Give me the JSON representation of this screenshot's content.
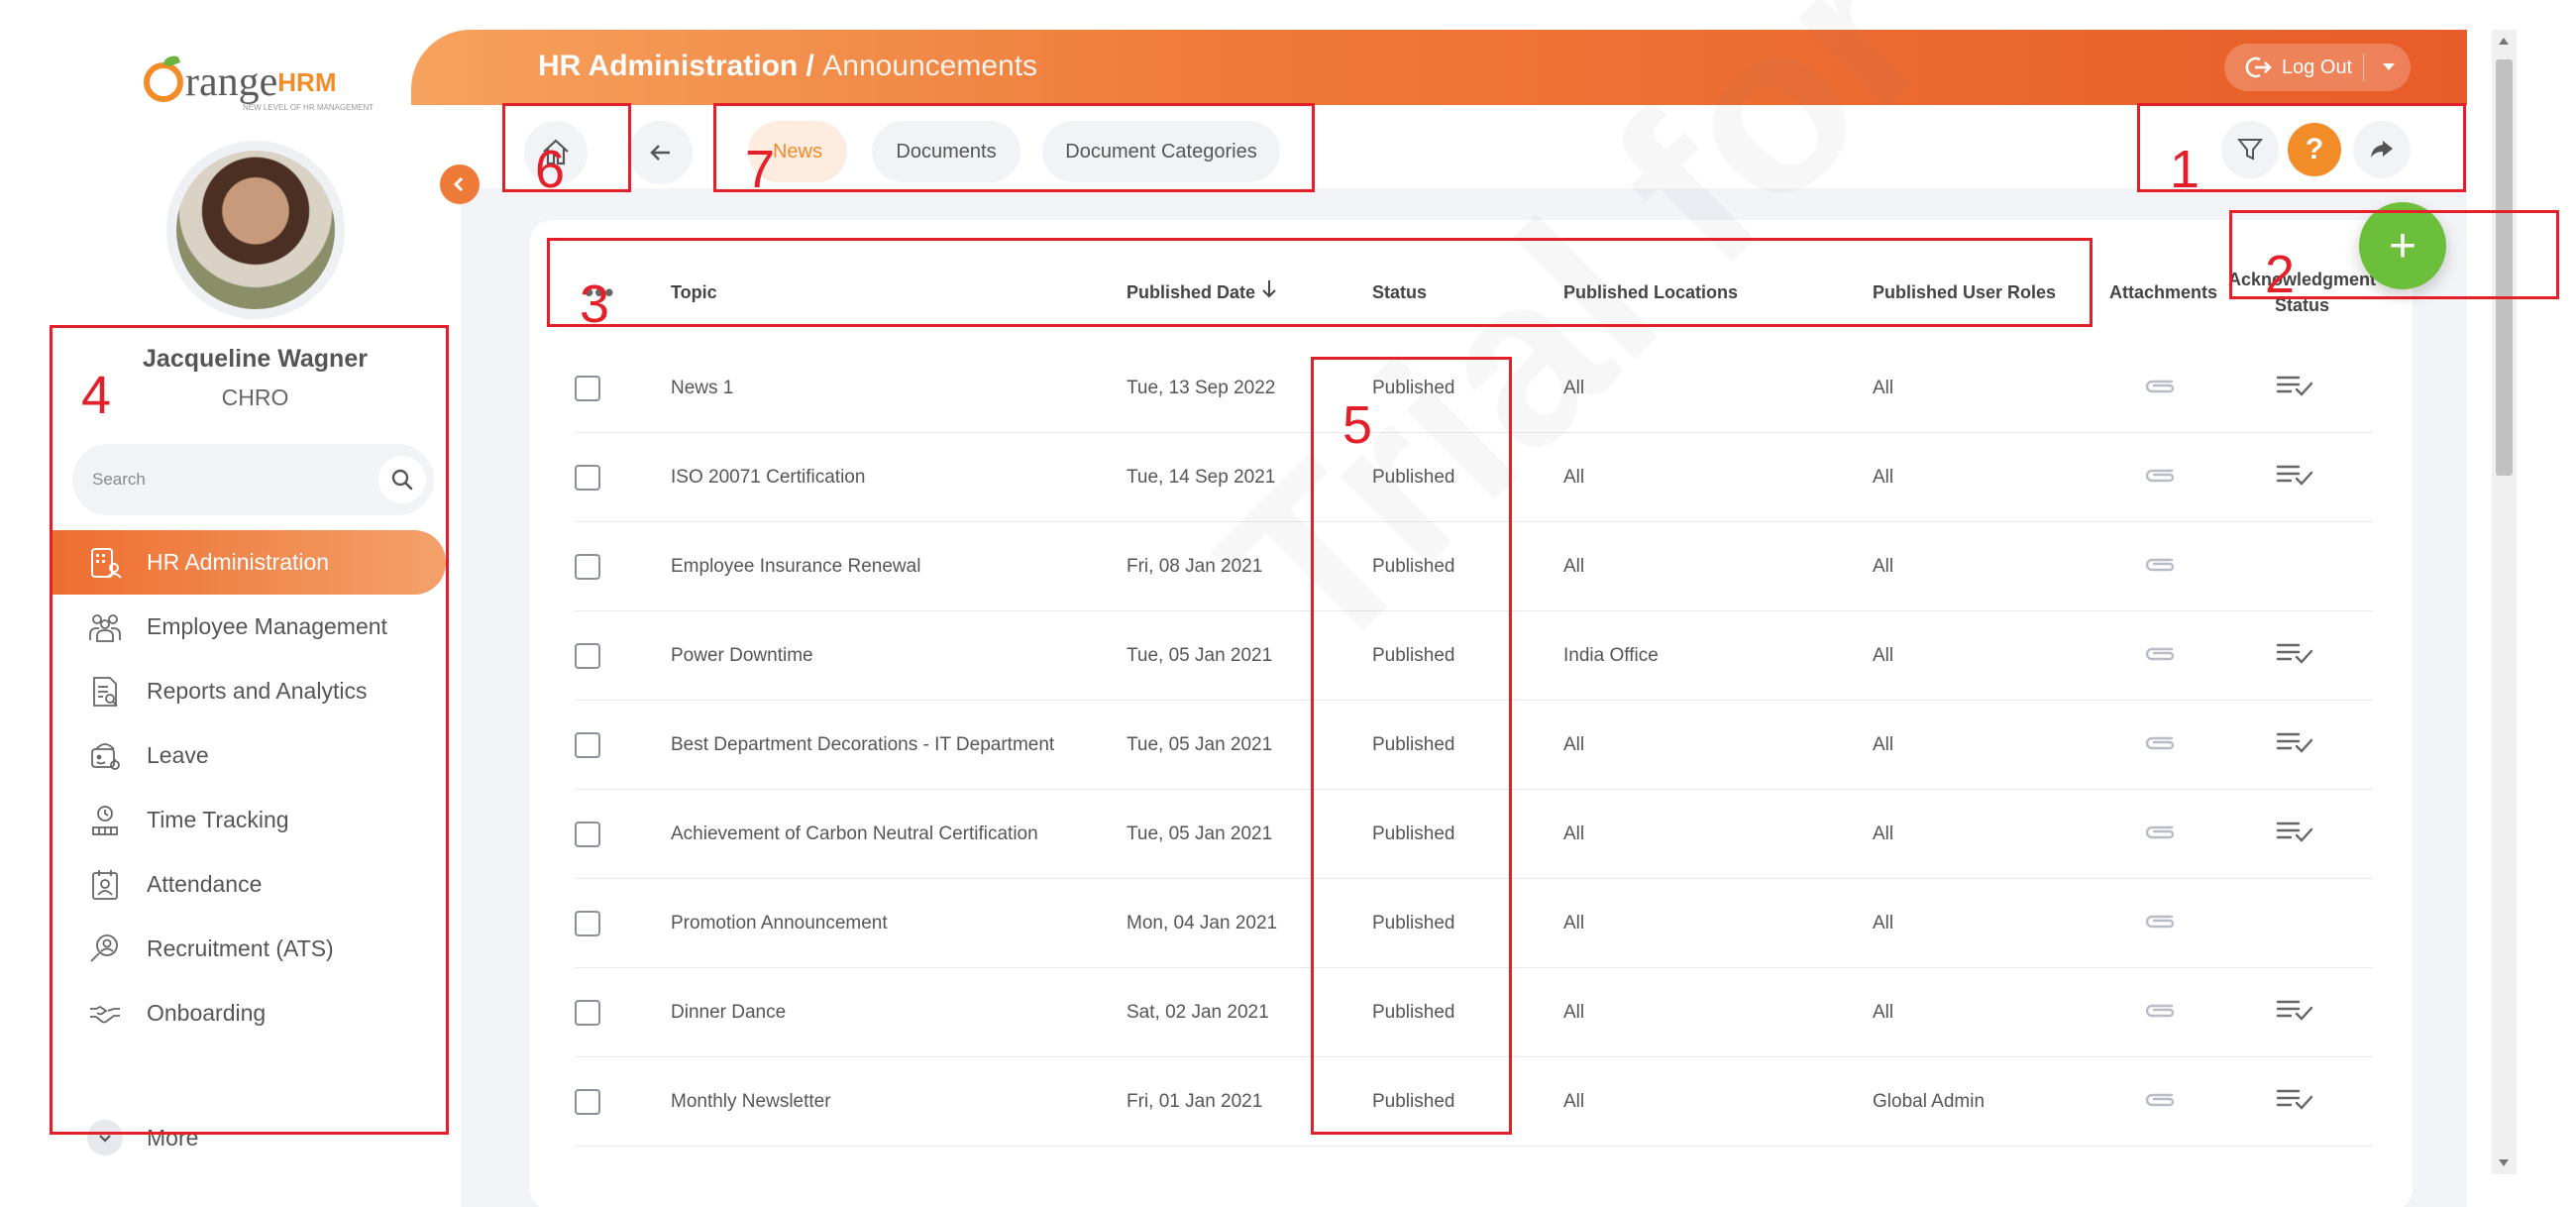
{
  "brand": {
    "logo_text": "range",
    "logo_hrm": "HRM",
    "logo_tagline": "NEW LEVEL OF HR MANAGEMENT"
  },
  "user": {
    "name": "Jacqueline Wagner",
    "role": "CHRO"
  },
  "search": {
    "placeholder": "Search"
  },
  "sidebar": {
    "items": [
      {
        "label": "HR Administration",
        "icon": "hr-admin-icon",
        "active": true
      },
      {
        "label": "Employee Management",
        "icon": "employees-icon",
        "active": false
      },
      {
        "label": "Reports and Analytics",
        "icon": "reports-icon",
        "active": false
      },
      {
        "label": "Leave",
        "icon": "leave-icon",
        "active": false
      },
      {
        "label": "Time Tracking",
        "icon": "time-tracking-icon",
        "active": false
      },
      {
        "label": "Attendance",
        "icon": "attendance-icon",
        "active": false
      },
      {
        "label": "Recruitment (ATS)",
        "icon": "recruitment-icon",
        "active": false
      },
      {
        "label": "Onboarding",
        "icon": "onboarding-icon",
        "active": false
      }
    ],
    "more_label": "More"
  },
  "header": {
    "title_main": "HR Administration /",
    "title_sub": "Announcements",
    "logout_label": "Log Out"
  },
  "subnav": {
    "tabs": [
      {
        "label": "News",
        "active": true
      },
      {
        "label": "Documents",
        "active": false
      },
      {
        "label": "Document Categories",
        "active": false
      }
    ],
    "help_glyph": "?"
  },
  "table": {
    "headers": {
      "topic": "Topic",
      "published_date": "Published Date",
      "status": "Status",
      "published_locations": "Published Locations",
      "published_user_roles": "Published User Roles",
      "attachments": "Attachments",
      "acknowledgment_status_line1": "Acknowledgment",
      "acknowledgment_status_line2": "Status"
    },
    "rows": [
      {
        "topic": "News 1",
        "date": "Tue, 13 Sep 2022",
        "status": "Published",
        "locations": "All",
        "roles": "All",
        "ack": true
      },
      {
        "topic": "ISO 20071 Certification",
        "date": "Tue, 14 Sep 2021",
        "status": "Published",
        "locations": "All",
        "roles": "All",
        "ack": true
      },
      {
        "topic": "Employee Insurance Renewal",
        "date": "Fri, 08 Jan 2021",
        "status": "Published",
        "locations": "All",
        "roles": "All",
        "ack": false
      },
      {
        "topic": "Power Downtime",
        "date": "Tue, 05 Jan 2021",
        "status": "Published",
        "locations": "India Office",
        "roles": "All",
        "ack": true
      },
      {
        "topic": "Best Department Decorations - IT Department",
        "date": "Tue, 05 Jan 2021",
        "status": "Published",
        "locations": "All",
        "roles": "All",
        "ack": true
      },
      {
        "topic": "Achievement of Carbon Neutral Certification",
        "date": "Tue, 05 Jan 2021",
        "status": "Published",
        "locations": "All",
        "roles": "All",
        "ack": true
      },
      {
        "topic": "Promotion Announcement",
        "date": "Mon, 04 Jan 2021",
        "status": "Published",
        "locations": "All",
        "roles": "All",
        "ack": false
      },
      {
        "topic": "Dinner Dance",
        "date": "Sat, 02 Jan 2021",
        "status": "Published",
        "locations": "All",
        "roles": "All",
        "ack": true
      },
      {
        "topic": "Monthly Newsletter",
        "date": "Fri, 01 Jan 2021",
        "status": "Published",
        "locations": "All",
        "roles": "Global Admin",
        "ack": true
      }
    ]
  },
  "fab": {
    "glyph": "+"
  },
  "watermark": "Trial for OrangeHRM",
  "annotations": [
    {
      "label": "1"
    },
    {
      "label": "2"
    },
    {
      "label": "3"
    },
    {
      "label": "4"
    },
    {
      "label": "5"
    },
    {
      "label": "6"
    },
    {
      "label": "7"
    }
  ],
  "colors": {
    "brand_orange": "#f28c28",
    "header_gradient_start": "#f6a25e",
    "header_gradient_end": "#e85c2a",
    "fab_green": "#6cbf3a",
    "annotation_red": "#e3202a"
  }
}
